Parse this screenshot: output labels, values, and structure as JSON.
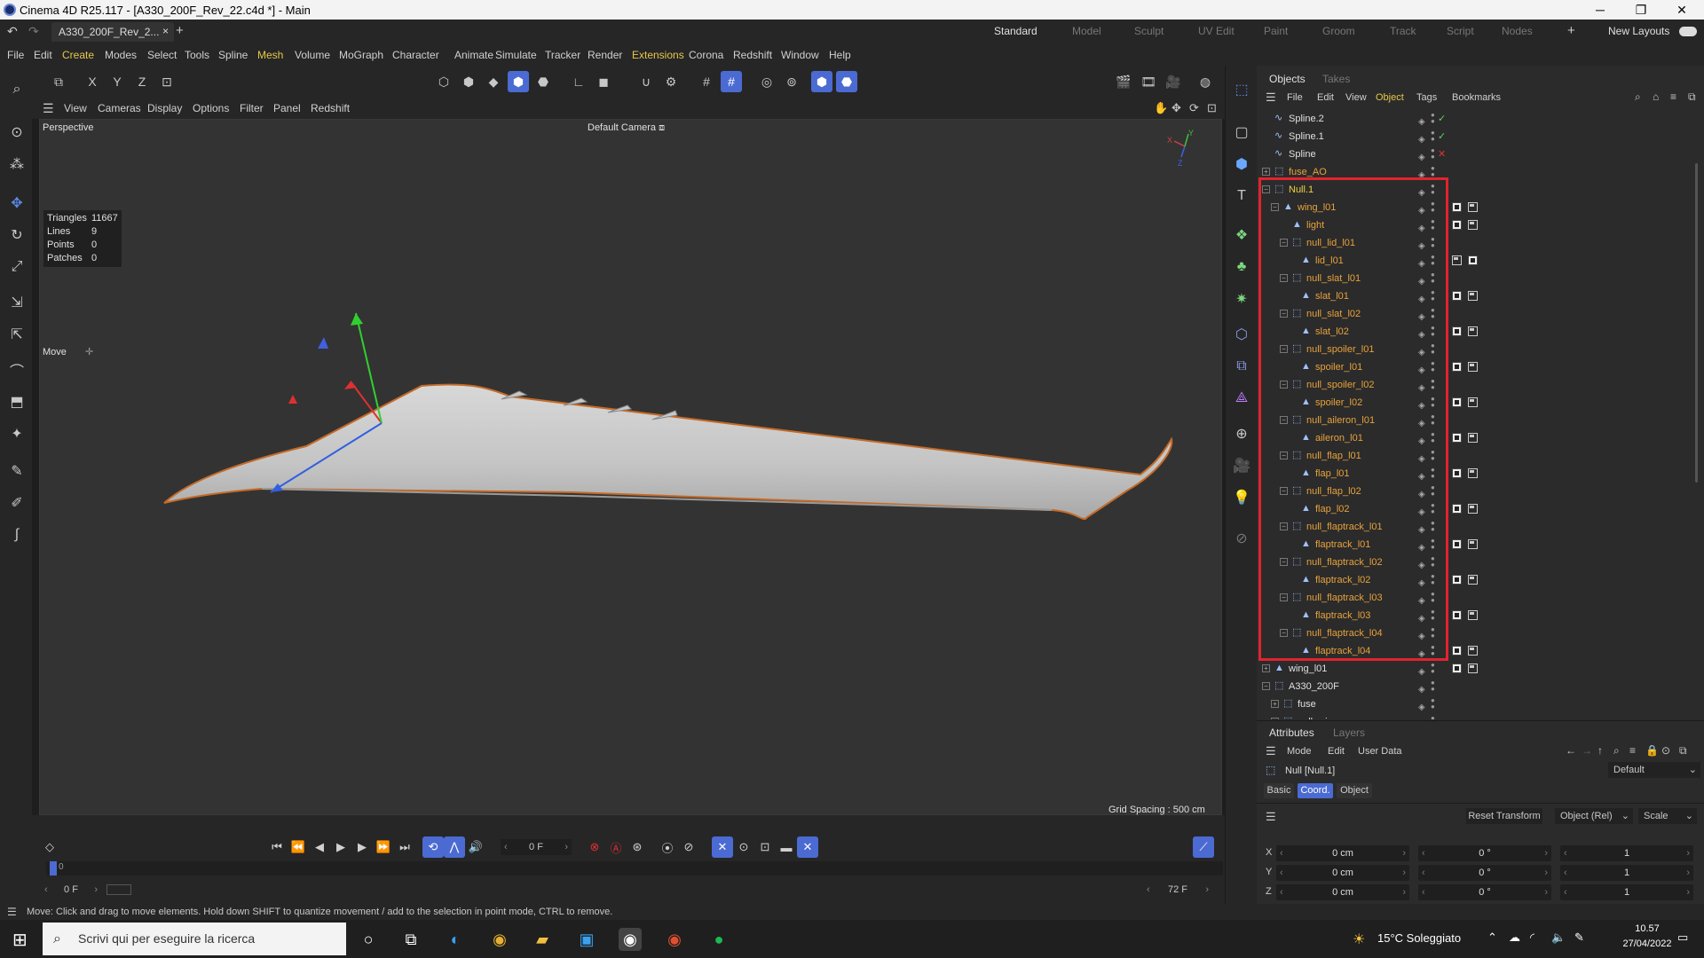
{
  "window": {
    "title": "Cinema 4D R25.117 - [A330_200F_Rev_22.c4d *] - Main",
    "minimize": "─",
    "restore": "❐",
    "close": "✕"
  },
  "tabs": {
    "document": "A330_200F_Rev_2...",
    "close": "×",
    "add": "+",
    "layouts": [
      "Standard",
      "Model",
      "Sculpt",
      "UV Edit",
      "Paint",
      "Groom",
      "Track",
      "Script",
      "Nodes"
    ],
    "add_layout": "+",
    "new_layouts": "New Layouts"
  },
  "menu": [
    "File",
    "Edit",
    "Create",
    "Modes",
    "Select",
    "Tools",
    "Spline",
    "Mesh",
    "Volume",
    "MoGraph",
    "Character",
    "Animate",
    "Simulate",
    "Tracker",
    "Render",
    "Extensions",
    "Corona",
    "Redshift",
    "Window",
    "Help"
  ],
  "toolbar": {
    "x": "X",
    "y": "Y",
    "z": "Z"
  },
  "viewport_menu": [
    "View",
    "Cameras",
    "Display",
    "Options",
    "Filter",
    "Panel",
    "Redshift"
  ],
  "viewport": {
    "name": "Perspective",
    "camera": "Default Camera",
    "camera_icon": "⧈",
    "stats": [
      {
        "label": "Triangles",
        "value": "11667"
      },
      {
        "label": "Lines",
        "value": "9"
      },
      {
        "label": "Points",
        "value": "0"
      },
      {
        "label": "Patches",
        "value": "0"
      }
    ],
    "tool": "Move",
    "tool_icon": "✛",
    "grid_spacing": "Grid Spacing : 500 cm",
    "axis_x": "X",
    "axis_y": "Y",
    "axis_z": "Z"
  },
  "objects_panel": {
    "tab_objects": "Objects",
    "tab_takes": "Takes",
    "menu": [
      "File",
      "Edit",
      "View",
      "Object",
      "Tags",
      "Bookmarks"
    ],
    "rows": [
      {
        "name": "Spline.2",
        "indent": 0,
        "color": "white",
        "icon": "∿",
        "expand": "",
        "check": "green"
      },
      {
        "name": "Spline.1",
        "indent": 0,
        "color": "white",
        "icon": "∿",
        "expand": "",
        "check": "green"
      },
      {
        "name": "Spline",
        "indent": 0,
        "color": "white",
        "icon": "∿",
        "expand": "",
        "check": "red"
      },
      {
        "name": "fuse_AO",
        "indent": 0,
        "color": "orange",
        "icon": "⬚",
        "expand": "+",
        "check": ""
      },
      {
        "name": "Null.1",
        "indent": 0,
        "color": "yellow",
        "icon": "⬚",
        "expand": "−",
        "check": ""
      },
      {
        "name": "wing_l01",
        "indent": 1,
        "color": "orange",
        "icon": "▲",
        "expand": "−",
        "check": "",
        "tags": true
      },
      {
        "name": "light",
        "indent": 2,
        "color": "orange",
        "icon": "▲",
        "expand": "",
        "check": "",
        "tags": true
      },
      {
        "name": "null_lid_l01",
        "indent": 2,
        "color": "orange",
        "icon": "⬚",
        "expand": "−",
        "check": ""
      },
      {
        "name": "lid_l01",
        "indent": 3,
        "color": "orange",
        "icon": "▲",
        "expand": "",
        "check": "",
        "tags": "rev"
      },
      {
        "name": "null_slat_l01",
        "indent": 2,
        "color": "orange",
        "icon": "⬚",
        "expand": "−",
        "check": ""
      },
      {
        "name": "slat_l01",
        "indent": 3,
        "color": "orange",
        "icon": "▲",
        "expand": "",
        "check": "",
        "tags": true
      },
      {
        "name": "null_slat_l02",
        "indent": 2,
        "color": "orange",
        "icon": "⬚",
        "expand": "−",
        "check": ""
      },
      {
        "name": "slat_l02",
        "indent": 3,
        "color": "orange",
        "icon": "▲",
        "expand": "",
        "check": "",
        "tags": true
      },
      {
        "name": "null_spoiler_l01",
        "indent": 2,
        "color": "orange",
        "icon": "⬚",
        "expand": "−",
        "check": ""
      },
      {
        "name": "spoiler_l01",
        "indent": 3,
        "color": "orange",
        "icon": "▲",
        "expand": "",
        "check": "",
        "tags": true
      },
      {
        "name": "null_spoiler_l02",
        "indent": 2,
        "color": "orange",
        "icon": "⬚",
        "expand": "−",
        "check": ""
      },
      {
        "name": "spoiler_l02",
        "indent": 3,
        "color": "orange",
        "icon": "▲",
        "expand": "",
        "check": "",
        "tags": true
      },
      {
        "name": "null_aileron_l01",
        "indent": 2,
        "color": "orange",
        "icon": "⬚",
        "expand": "−",
        "check": ""
      },
      {
        "name": "aileron_l01",
        "indent": 3,
        "color": "orange",
        "icon": "▲",
        "expand": "",
        "check": "",
        "tags": true
      },
      {
        "name": "null_flap_l01",
        "indent": 2,
        "color": "orange",
        "icon": "⬚",
        "expand": "−",
        "check": ""
      },
      {
        "name": "flap_l01",
        "indent": 3,
        "color": "orange",
        "icon": "▲",
        "expand": "",
        "check": "",
        "tags": true
      },
      {
        "name": "null_flap_l02",
        "indent": 2,
        "color": "orange",
        "icon": "⬚",
        "expand": "−",
        "check": ""
      },
      {
        "name": "flap_l02",
        "indent": 3,
        "color": "orange",
        "icon": "▲",
        "expand": "",
        "check": "",
        "tags": true
      },
      {
        "name": "null_flaptrack_l01",
        "indent": 2,
        "color": "orange",
        "icon": "⬚",
        "expand": "−",
        "check": ""
      },
      {
        "name": "flaptrack_l01",
        "indent": 3,
        "color": "orange",
        "icon": "▲",
        "expand": "",
        "check": "",
        "tags": true
      },
      {
        "name": "null_flaptrack_l02",
        "indent": 2,
        "color": "orange",
        "icon": "⬚",
        "expand": "−",
        "check": ""
      },
      {
        "name": "flaptrack_l02",
        "indent": 3,
        "color": "orange",
        "icon": "▲",
        "expand": "",
        "check": "",
        "tags": true
      },
      {
        "name": "null_flaptrack_l03",
        "indent": 2,
        "color": "orange",
        "icon": "⬚",
        "expand": "−",
        "check": ""
      },
      {
        "name": "flaptrack_l03",
        "indent": 3,
        "color": "orange",
        "icon": "▲",
        "expand": "",
        "check": "",
        "tags": true
      },
      {
        "name": "null_flaptrack_l04",
        "indent": 2,
        "color": "orange",
        "icon": "⬚",
        "expand": "−",
        "check": ""
      },
      {
        "name": "flaptrack_l04",
        "indent": 3,
        "color": "orange",
        "icon": "▲",
        "expand": "",
        "check": "",
        "tags": true
      },
      {
        "name": "wing_l01",
        "indent": 0,
        "color": "white",
        "icon": "▲",
        "expand": "+",
        "check": "",
        "tags": true
      },
      {
        "name": "A330_200F",
        "indent": 0,
        "color": "white",
        "icon": "⬚",
        "expand": "−",
        "check": ""
      },
      {
        "name": "fuse",
        "indent": 1,
        "color": "white",
        "icon": "⬚",
        "expand": "+",
        "check": ""
      },
      {
        "name": "null_winer_r",
        "indent": 1,
        "color": "white",
        "icon": "⬚",
        "expand": "+",
        "check": ""
      }
    ]
  },
  "attributes": {
    "tab_attributes": "Attributes",
    "tab_layers": "Layers",
    "menu": [
      "Mode",
      "Edit",
      "User Data"
    ],
    "object_label": "Null [Null.1]",
    "preset": "Default",
    "subtabs": [
      "Basic",
      "Coord.",
      "Object"
    ],
    "active_subtab": "Coord.",
    "reset_transform": "Reset Transform",
    "space": "Object (Rel)",
    "scale_label": "Scale",
    "rows": [
      {
        "axis": "X",
        "pos": "0 cm",
        "rot": "0 °",
        "scale": "1"
      },
      {
        "axis": "Y",
        "pos": "0 cm",
        "rot": "0 °",
        "scale": "1"
      },
      {
        "axis": "Z",
        "pos": "0 cm",
        "rot": "0 °",
        "scale": "1"
      }
    ]
  },
  "timeline": {
    "current_frame": "0 F",
    "start_frame": "0 F",
    "end_frame": "72 F",
    "ruler_zero": "0"
  },
  "status": "Move: Click and drag to move elements. Hold down SHIFT to quantize movement / add to the selection in point mode, CTRL to remove.",
  "taskbar": {
    "search_placeholder": "Scrivi qui per eseguire la ricerca",
    "weather": "15°C Soleggiato",
    "time": "10.57",
    "date": "27/04/2022"
  },
  "colors": {
    "accent": "#4b6bd3",
    "selection": "#e0242e",
    "object_orange": "#e8a23c",
    "object_yellow": "#f0d040"
  }
}
